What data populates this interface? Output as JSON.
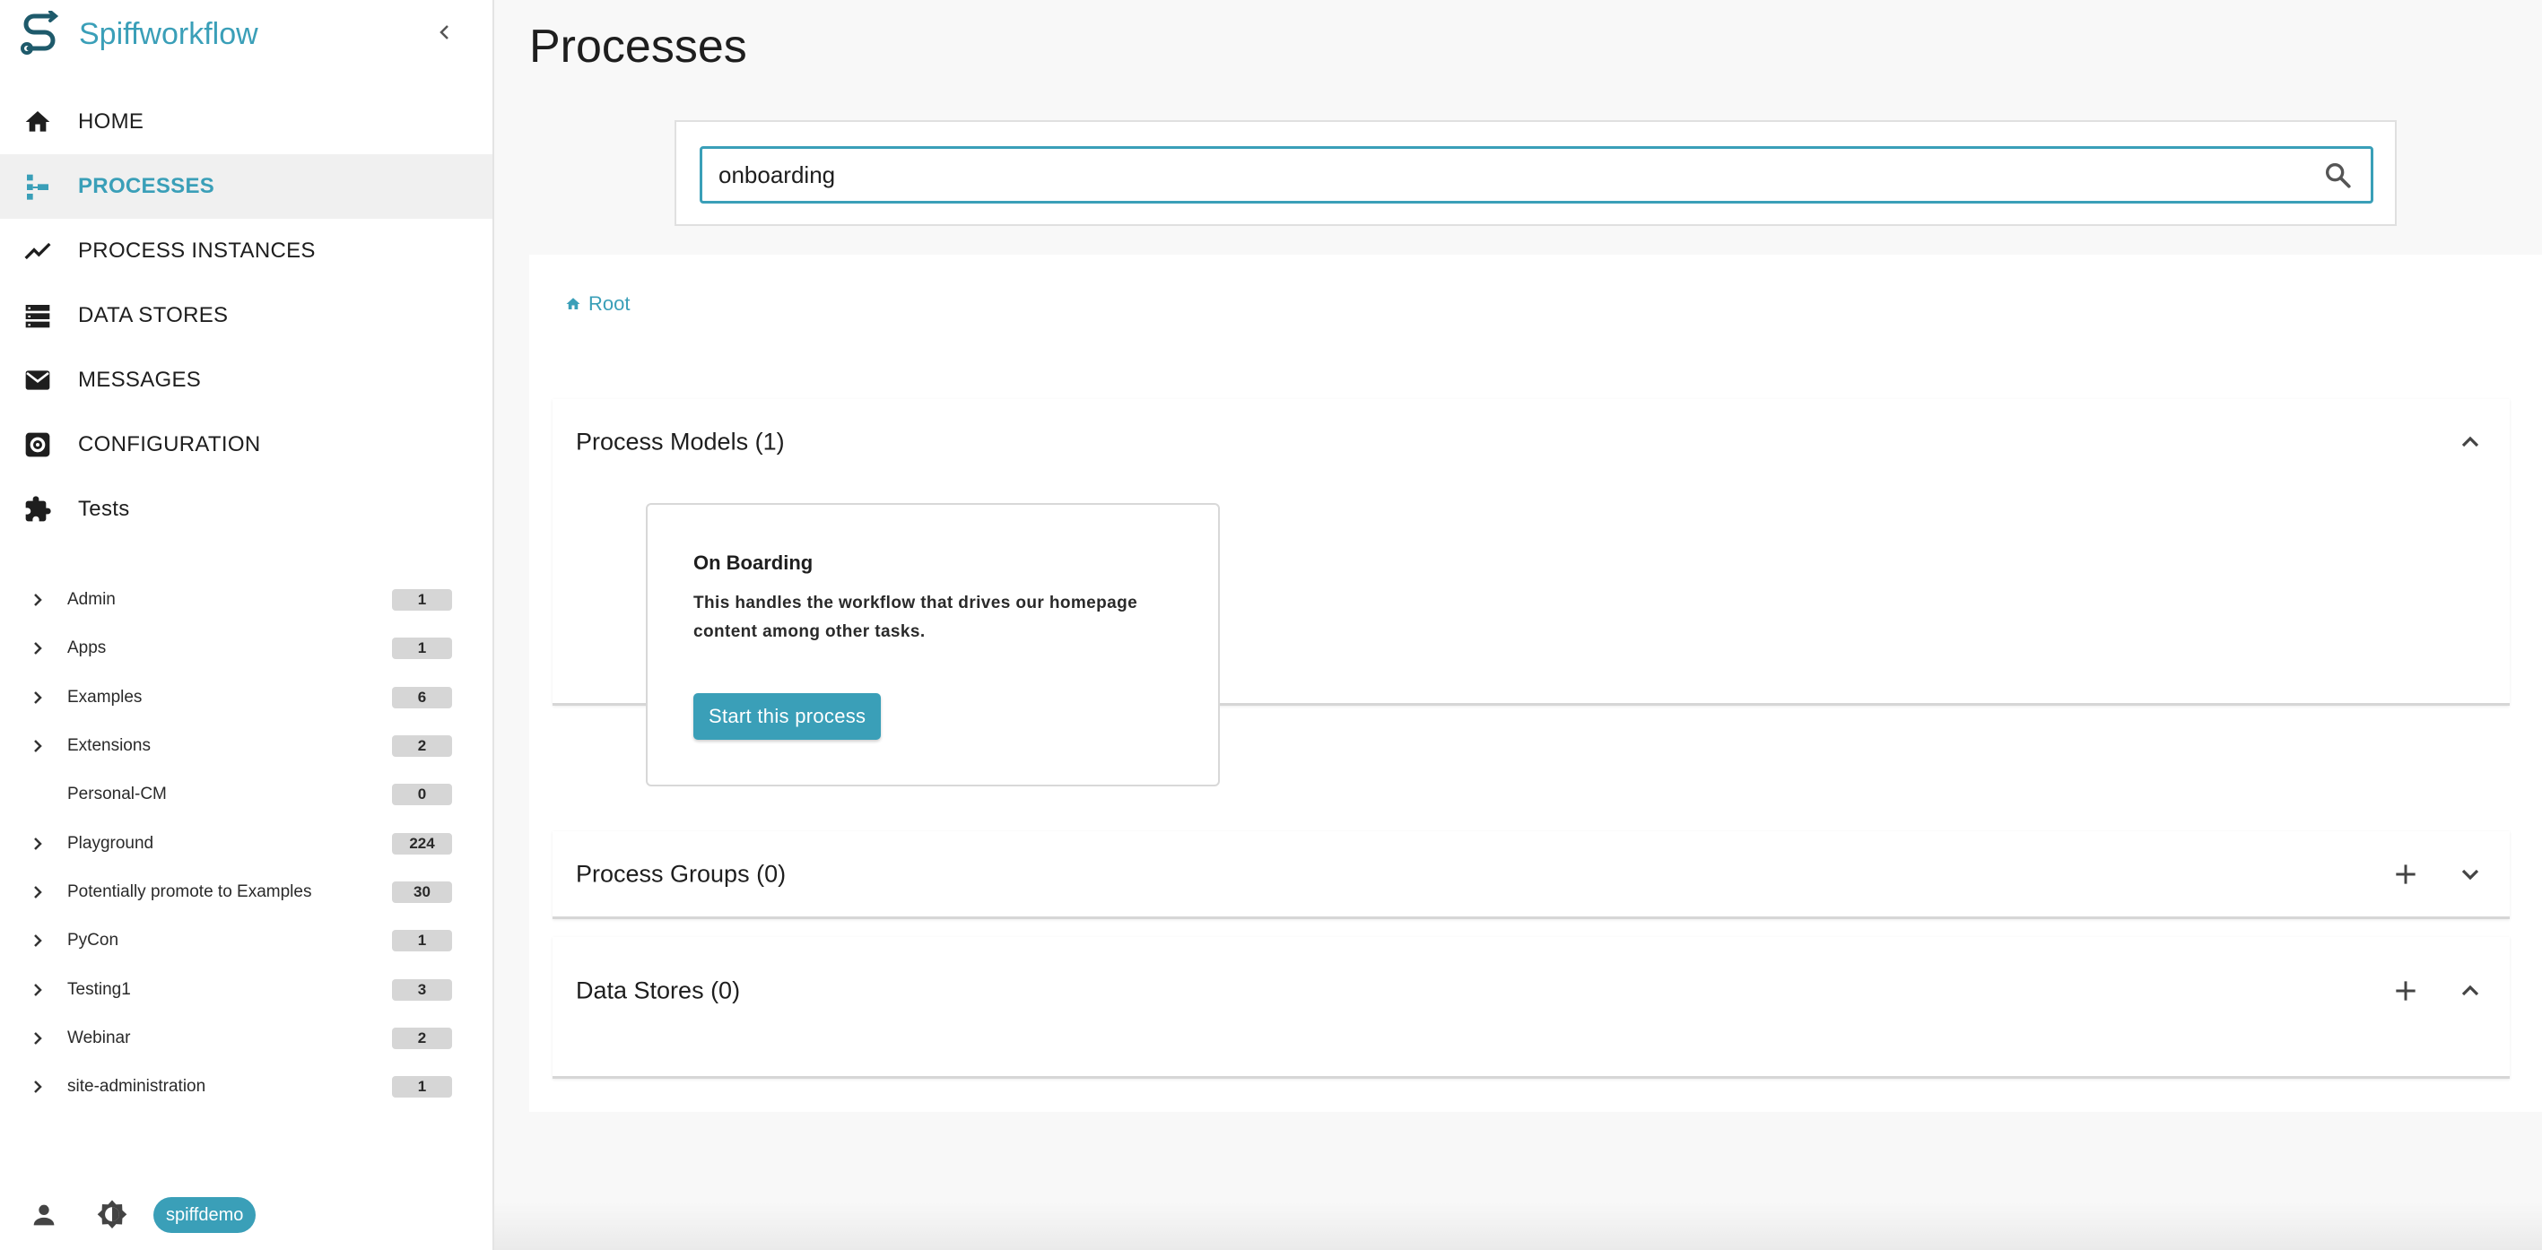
{
  "app": {
    "name": "Spiffworkflow"
  },
  "nav": {
    "home": "HOME",
    "processes": "PROCESSES",
    "process_instances": "PROCESS INSTANCES",
    "data_stores": "DATA STORES",
    "messages": "MESSAGES",
    "configuration": "CONFIGURATION",
    "tests": "Tests"
  },
  "groups": [
    {
      "label": "Admin",
      "count": "1",
      "expandable": true
    },
    {
      "label": "Apps",
      "count": "1",
      "expandable": true
    },
    {
      "label": "Examples",
      "count": "6",
      "expandable": true
    },
    {
      "label": "Extensions",
      "count": "2",
      "expandable": true
    },
    {
      "label": "Personal-CM",
      "count": "0",
      "expandable": false
    },
    {
      "label": "Playground",
      "count": "224",
      "expandable": true
    },
    {
      "label": "Potentially promote to Examples",
      "count": "30",
      "expandable": true
    },
    {
      "label": "PyCon",
      "count": "1",
      "expandable": true
    },
    {
      "label": "Testing1",
      "count": "3",
      "expandable": true
    },
    {
      "label": "Webinar",
      "count": "2",
      "expandable": true
    },
    {
      "label": "site-administration",
      "count": "1",
      "expandable": true
    }
  ],
  "footer": {
    "username": "spiffdemo"
  },
  "page": {
    "title": "Processes"
  },
  "search": {
    "value": "onboarding"
  },
  "breadcrumb": {
    "root": "Root"
  },
  "sections": {
    "process_models": {
      "title": "Process Models (1)"
    },
    "process_groups": {
      "title": "Process Groups (0)"
    },
    "data_stores": {
      "title": "Data Stores (0)"
    }
  },
  "model_card": {
    "title": "On Boarding",
    "description": "This handles the workflow that drives our homepage content among other tasks.",
    "start_label": "Start this process"
  },
  "colors": {
    "accent": "#3a9fb8"
  }
}
